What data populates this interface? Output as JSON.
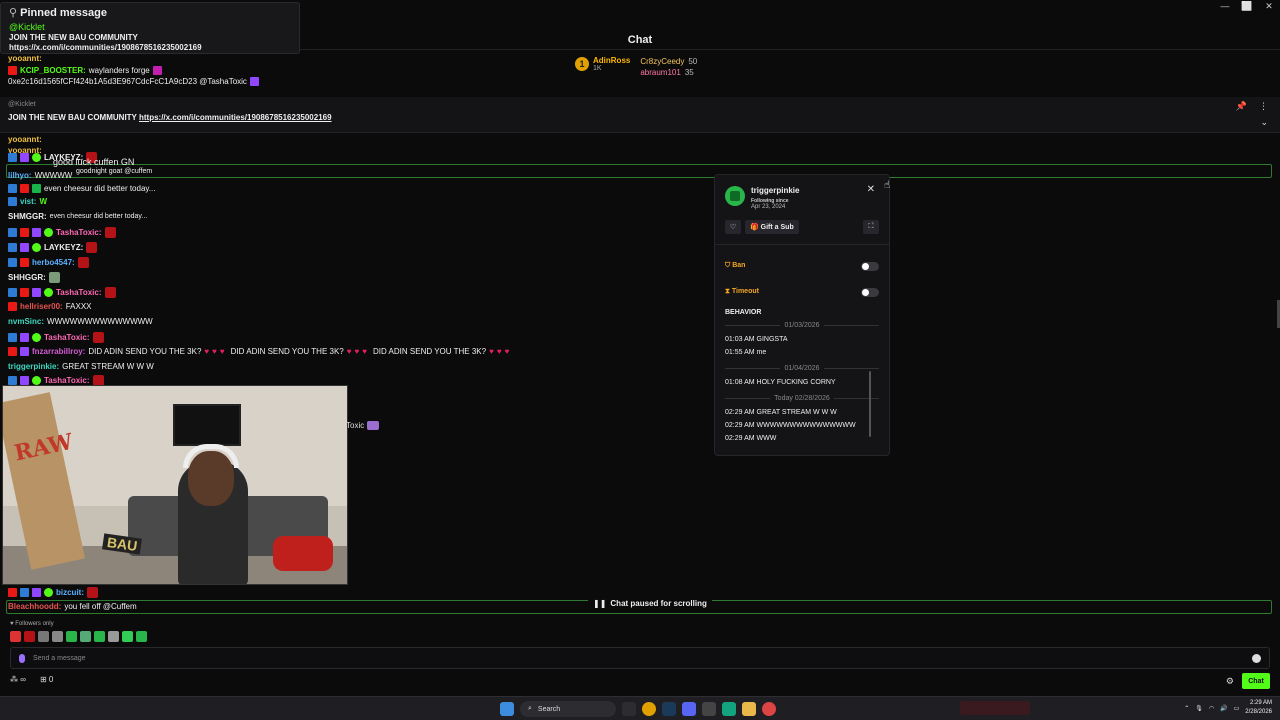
{
  "window": {
    "controls": [
      "—",
      "⬜",
      "✕"
    ]
  },
  "pinned_popup": {
    "title": "Pinned message",
    "author": "@Kicklet",
    "line1": "JOIN THE NEW BAU COMMUNITY",
    "line2": "https://x.com/i/communities/1908678516235002169"
  },
  "header": {
    "title": "Chat"
  },
  "leaderboard": {
    "rank": "1",
    "top_name": "AdinRoss",
    "top_sub": "1K",
    "entries": [
      {
        "name": "Cr8zyCeedy",
        "count": "50"
      },
      {
        "name": "abraum101",
        "count": "35"
      }
    ]
  },
  "pin_bar": {
    "sender": "@Kicklet",
    "text": "JOIN THE NEW BAU COMMUNITY",
    "link": "https://x.com/i/communities/1908678516235002169"
  },
  "chat": [
    {
      "user": "yooannt:",
      "text": ""
    },
    {
      "user": "KCIP_BOOSTER:",
      "text": "waylanders forge"
    },
    {
      "user": "",
      "text": "0xe2c16d1565fCFf424b1A5d3E967CdcFcC1A9cD23 @TashaToxic"
    },
    {
      "user": "yooannt:",
      "text": ""
    },
    {
      "user": "yooannt:",
      "text": ""
    },
    {
      "user": "LAYKEYZ:",
      "text": ""
    },
    {
      "user": "",
      "text": "good luck cuffen GN"
    },
    {
      "user": "",
      "text": "goodnight goat @cuffem"
    },
    {
      "user": "lilhyo:",
      "text": "WWWWW"
    },
    {
      "user": "",
      "text": "even cheesur did better today..."
    },
    {
      "user": "vist:",
      "text": "W"
    },
    {
      "user": "SHMGGR:",
      "text": "even cheesur did better today..."
    },
    {
      "user": "TashaToxic:",
      "text": ""
    },
    {
      "user": "LAYKEYZ:",
      "text": ""
    },
    {
      "user": "herbo4547:",
      "text": ""
    },
    {
      "user": "SHHGGR:",
      "text": ""
    },
    {
      "user": "TashaToxic:",
      "text": ""
    },
    {
      "user": "hellriser00:",
      "text": "FAXXX"
    },
    {
      "user": "nvmSinc:",
      "text": "WWWWWWWWWWWWWW"
    },
    {
      "user": "TashaToxic:",
      "text": ""
    },
    {
      "user": "fnzarrabillroy:",
      "text": "DID ADIN SEND YOU THE 3K?"
    },
    {
      "user": "",
      "text": "DID ADIN SEND YOU THE 3K?"
    },
    {
      "user": "",
      "text": "DID ADIN SEND YOU THE 3K?"
    },
    {
      "user": "triggerpinkie:",
      "text": "GREAT STREAM W W W"
    },
    {
      "user": "TashaToxic:",
      "text": ""
    },
    {
      "user": "bizcuit:",
      "text": ""
    },
    {
      "user": "Bleachhoodd:",
      "text": "you fell off @Cuffem"
    }
  ],
  "toxic_tag": "Toxic",
  "user_card": {
    "username": "triggerpinkie",
    "following_label": "Following since",
    "following_date": "Apr 23, 2024",
    "gift_label": "Gift a Sub",
    "ban_label": "Ban",
    "timeout_label": "Timeout",
    "behavior_label": "BEHAVIOR",
    "groups": [
      {
        "date": "01/03/2026",
        "entries": [
          "01:03 AM GINGSTA",
          "01:55 AM me"
        ]
      },
      {
        "date": "01/04/2026",
        "entries": [
          "01:08 AM HOLY FUCKING CORNY"
        ]
      },
      {
        "date": "Today 02/28/2026",
        "entries": [
          "02:29 AM GREAT STREAM W W W",
          "02:29 AM WWWWWWWWWWWWWWW",
          "02:29 AM WWW"
        ]
      }
    ]
  },
  "paused": "Chat paused for scrolling",
  "input": {
    "followers_only": "Followers only",
    "placeholder": "Send a message",
    "infinity": "∞",
    "count": "0",
    "chat_button": "Chat"
  },
  "taskbar": {
    "search": "Search",
    "time": "2:29 AM",
    "date": "2/28/2026"
  },
  "colors": {
    "accent": "#53fc18",
    "background": "#0b0b0c"
  }
}
